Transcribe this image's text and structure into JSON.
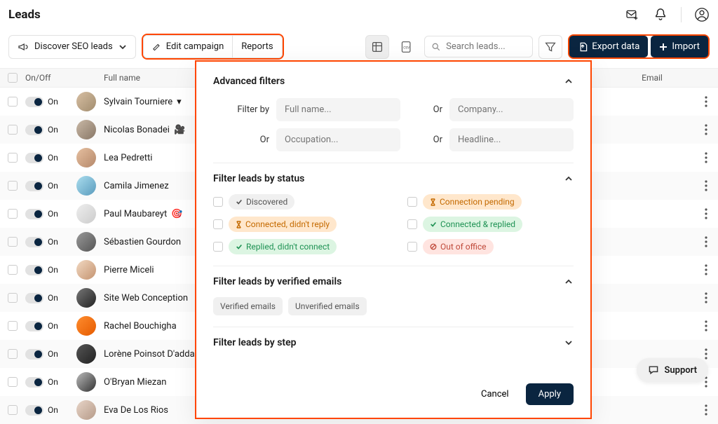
{
  "header": {
    "title": "Leads"
  },
  "toolbar": {
    "dropdown_label": "Discover SEO leads",
    "edit_campaign_label": "Edit campaign",
    "reports_label": "Reports",
    "search_placeholder": "Search leads...",
    "export_label": "Export data",
    "import_label": "Import"
  },
  "table": {
    "headers": {
      "onoff": "On/Off",
      "fullname": "Full name",
      "email": "Email"
    },
    "rows": [
      {
        "on": "On",
        "name": "Sylvain Tourniere",
        "icon": "▾"
      },
      {
        "on": "On",
        "name": "Nicolas Bonadei",
        "icon": "🎥"
      },
      {
        "on": "On",
        "name": "Lea Pedretti",
        "icon": ""
      },
      {
        "on": "On",
        "name": "Camila Jimenez",
        "icon": ""
      },
      {
        "on": "On",
        "name": "Paul Maubareyt",
        "icon": "🎯"
      },
      {
        "on": "On",
        "name": "Sébastien Gourdon",
        "icon": ""
      },
      {
        "on": "On",
        "name": "Pierre Miceli",
        "icon": ""
      },
      {
        "on": "On",
        "name": "Site Web Conception",
        "icon": ""
      },
      {
        "on": "On",
        "name": "Rachel Bouchigha",
        "icon": ""
      },
      {
        "on": "On",
        "name": "Lorène Poinsot D'addario",
        "icon": ""
      },
      {
        "on": "On",
        "name": "O'Bryan Miezan",
        "icon": ""
      },
      {
        "on": "On",
        "name": "Eva De Los Rios",
        "icon": ""
      }
    ]
  },
  "panel": {
    "advanced_filters": {
      "title": "Advanced filters",
      "filter_by": "Filter by",
      "or": "Or",
      "placeholders": {
        "fullname": "Full name...",
        "company": "Company...",
        "occupation": "Occupation...",
        "headline": "Headline..."
      }
    },
    "status": {
      "title": "Filter leads by status",
      "items": [
        {
          "label": "Discovered",
          "style": "gray",
          "icon": "check"
        },
        {
          "label": "Connection pending",
          "style": "orange",
          "icon": "hourglass"
        },
        {
          "label": "Connected, didn't reply",
          "style": "orange",
          "icon": "hourglass"
        },
        {
          "label": "Connected & replied",
          "style": "green",
          "icon": "check"
        },
        {
          "label": "Replied, didn't connect",
          "style": "green",
          "icon": "check"
        },
        {
          "label": "Out of office",
          "style": "red",
          "icon": "no"
        }
      ]
    },
    "emails": {
      "title": "Filter leads by verified emails",
      "chips": [
        "Verified emails",
        "Unverified emails"
      ]
    },
    "step": {
      "title": "Filter leads by step"
    },
    "footer": {
      "cancel": "Cancel",
      "apply": "Apply"
    }
  },
  "support": {
    "label": "Support"
  }
}
